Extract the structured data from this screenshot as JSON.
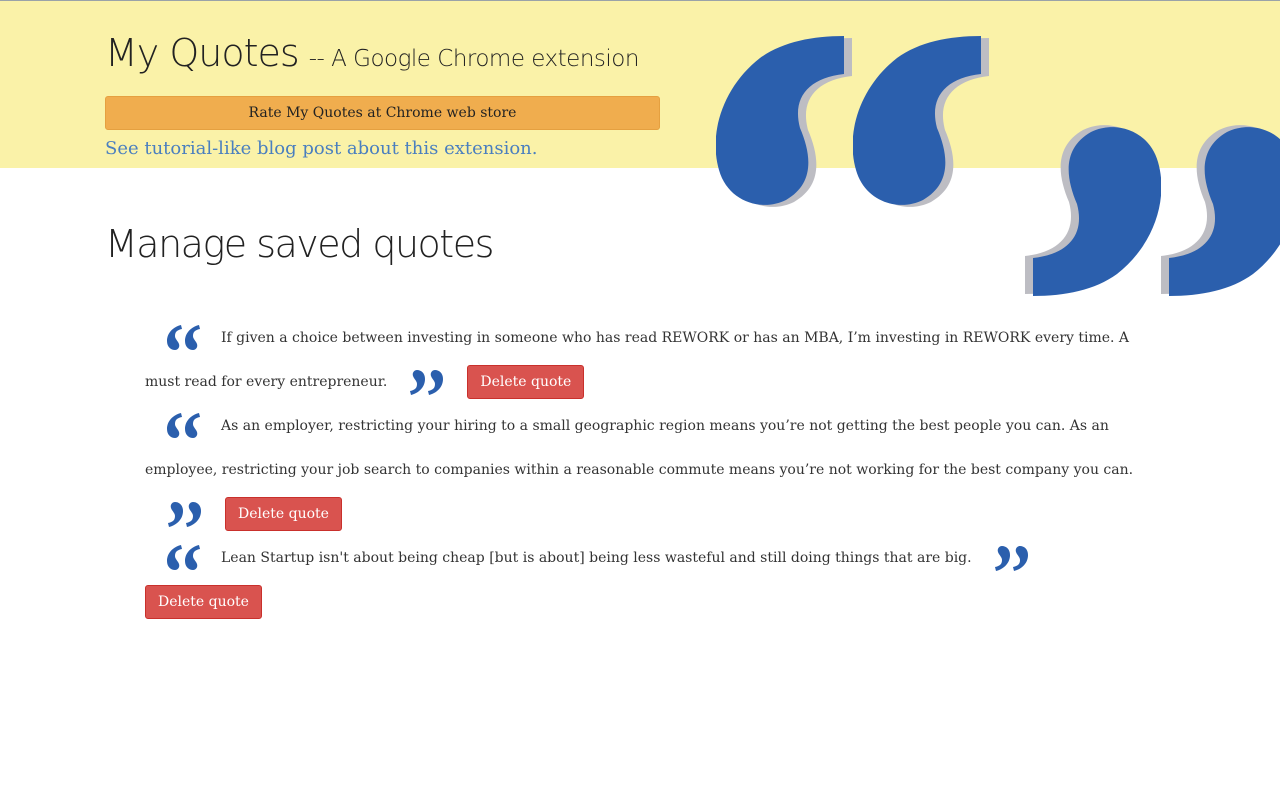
{
  "header": {
    "title": "My Quotes",
    "subtitle": "-- A Google Chrome extension",
    "rate_button_label": "Rate My Quotes at Chrome web store",
    "blog_link_text": "See tutorial-like blog post about this extension."
  },
  "main": {
    "section_title": "Manage saved quotes",
    "quotes": [
      {
        "text": "If given a choice between investing in someone who has read REWORK or has an MBA, I’m investing in REWORK every time. A must read for every entrepreneur.",
        "delete_label": "Delete quote"
      },
      {
        "text": "As an employer, restricting your hiring to a small geographic region means you’re not getting the best people you can. As an employee, restricting your job search to companies within a reasonable commute means you’re not working for the best company you can.",
        "delete_label": "Delete quote"
      },
      {
        "text": "Lean Startup isn't about being cheap [but is about] being less wasteful and still doing things that are big.",
        "delete_label": "Delete quote"
      }
    ]
  },
  "icons": {
    "decorative": "big-quotation-marks-icon",
    "open": "open-quote-icon",
    "close": "close-quote-icon"
  },
  "colors": {
    "header_bg": "#faf2a8",
    "quote_blue": "#2b5fad",
    "quote_shadow": "#bdbdc3",
    "rate_button": "#f0ad4e",
    "delete_button": "#d9534f",
    "link": "#4a7fbf"
  }
}
